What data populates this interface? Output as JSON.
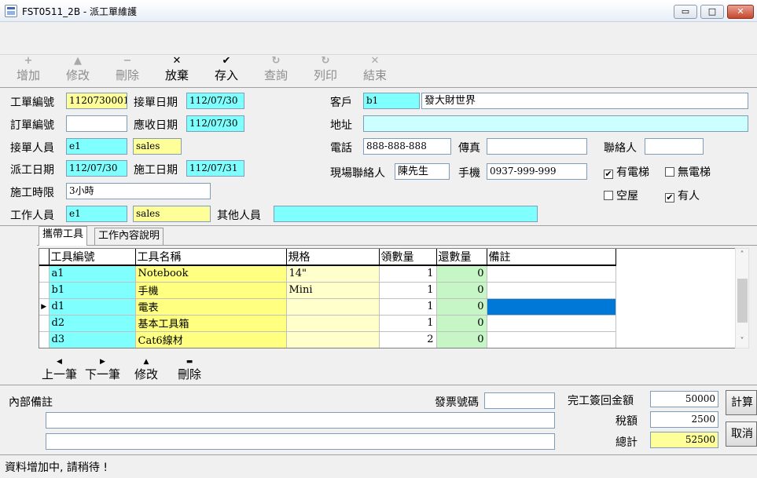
{
  "window": {
    "title": "FST0511_2B - 派工單維護",
    "min_glyph": "▭",
    "max_glyph": "□",
    "close_glyph": "✕"
  },
  "toolbar": [
    {
      "label": "增加",
      "icon": "+",
      "enabled": false
    },
    {
      "label": "修改",
      "icon": "▲",
      "enabled": false
    },
    {
      "label": "刪除",
      "icon": "−",
      "enabled": false
    },
    {
      "label": "放棄",
      "icon": "✕",
      "enabled": true
    },
    {
      "label": "存入",
      "icon": "✔",
      "enabled": true
    },
    {
      "label": "查詢",
      "icon": "↻",
      "enabled": false
    },
    {
      "label": "列印",
      "icon": "↻",
      "enabled": false
    },
    {
      "label": "結束",
      "icon": "✕",
      "enabled": false
    }
  ],
  "form": {
    "work_order_no_label": "工單編號",
    "work_order_no": "1120730001",
    "receive_date_label": "接單日期",
    "receive_date": "112/07/30",
    "order_no_label": "訂單編號",
    "order_no": "",
    "due_date_label": "應收日期",
    "due_date": "112/07/30",
    "receiver_label": "接單人員",
    "receiver_code": "e1",
    "receiver_name": "sales",
    "dispatch_date_label": "派工日期",
    "dispatch_date": "112/07/30",
    "work_date_label": "施工日期",
    "work_date": "112/07/31",
    "duration_label": "施工時限",
    "duration": "3小時",
    "worker_label": "工作人員",
    "worker_code": "e1",
    "worker_name": "sales",
    "other_staff_label": "其他人員",
    "other_staff": "",
    "customer_label": "客戶",
    "customer_code": "b1",
    "customer_name": "發大財世界",
    "address_label": "地址",
    "address": "",
    "phone_label": "電話",
    "phone": "888-888-888",
    "fax_label": "傳真",
    "fax": "",
    "contact_label": "聯絡人",
    "contact": "",
    "site_contact_label": "現場聯絡人",
    "site_contact": "陳先生",
    "mobile_label": "手機",
    "mobile": "0937-999-999",
    "check_mark": "✔",
    "checkboxes": [
      {
        "label": "有電梯",
        "checked": true
      },
      {
        "label": "無電梯",
        "checked": false
      },
      {
        "label": "空屋",
        "checked": false
      },
      {
        "label": "有人",
        "checked": true
      }
    ]
  },
  "tabs": [
    {
      "label": "攜帶工具",
      "active": true
    },
    {
      "label": "工作內容說明",
      "active": false
    }
  ],
  "grid": {
    "columns": [
      "工具編號",
      "工具名稱",
      "規格",
      "領數量",
      "還數量",
      "備註"
    ],
    "current_row_marker": "▶",
    "rows": [
      {
        "code": "a1",
        "name": "Notebook",
        "spec": "14\"",
        "out_qty": "1",
        "ret_qty": "0",
        "note": "",
        "current": false
      },
      {
        "code": "b1",
        "name": "手機",
        "spec": "Mini",
        "out_qty": "1",
        "ret_qty": "0",
        "note": "",
        "current": false
      },
      {
        "code": "d1",
        "name": "電表",
        "spec": "",
        "out_qty": "1",
        "ret_qty": "0",
        "note": "",
        "current": true
      },
      {
        "code": "d2",
        "name": "基本工具箱",
        "spec": "",
        "out_qty": "1",
        "ret_qty": "0",
        "note": "",
        "current": false
      },
      {
        "code": "d3",
        "name": "Cat6線材",
        "spec": "",
        "out_qty": "2",
        "ret_qty": "0",
        "note": "",
        "current": false
      }
    ],
    "scroll_up": "˄",
    "scroll_down": "˅"
  },
  "grid_nav": [
    {
      "label": "上一筆",
      "icon": "◀"
    },
    {
      "label": "下一筆",
      "icon": "▶"
    },
    {
      "label": "修改",
      "icon": "▲"
    },
    {
      "label": "刪除",
      "icon": "▬"
    }
  ],
  "bottom": {
    "internal_note_label": "內部備註",
    "internal_note_line1": "",
    "internal_note_line2": "",
    "invoice_label": "發票號碼",
    "invoice": "",
    "rebate_label": "完工簽回金額",
    "rebate": "50000",
    "tax_label": "稅額",
    "tax": "2500",
    "total_label": "總計",
    "total": "52500",
    "calc_button": "計算",
    "cancel_button": "取消"
  },
  "status": {
    "message": "資料增加中, 請稍待 !"
  }
}
